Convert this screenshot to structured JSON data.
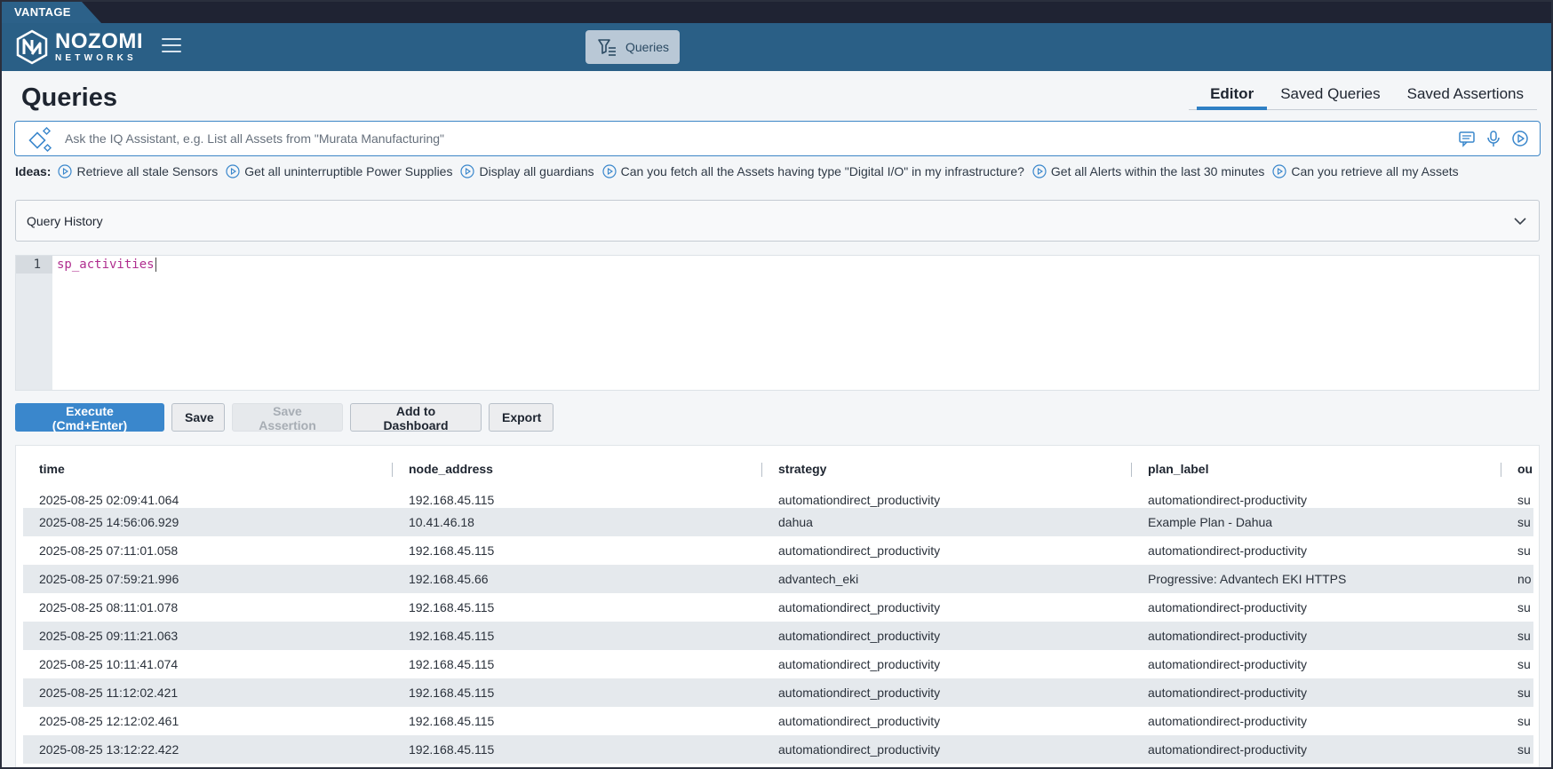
{
  "app": {
    "brand_strip": "VANTAGE",
    "logo_name": "NOZOMI",
    "logo_sub": "NETWORKS"
  },
  "nav": {
    "queries_label": "Queries"
  },
  "page": {
    "title": "Queries",
    "tabs": [
      {
        "label": "Editor",
        "active": true
      },
      {
        "label": "Saved Queries",
        "active": false
      },
      {
        "label": "Saved Assertions",
        "active": false
      }
    ]
  },
  "assistant": {
    "placeholder": "Ask the IQ Assistant, e.g. List all Assets from \"Murata Manufacturing\""
  },
  "ideas": {
    "label": "Ideas:",
    "items": [
      "Retrieve all stale Sensors",
      "Get all uninterruptible Power Supplies",
      "Display all guardians",
      "Can you fetch all the Assets having type \"Digital I/O\" in my infrastructure?",
      "Get all Alerts within the last 30 minutes",
      "Can you retrieve all my Assets"
    ]
  },
  "query_history": {
    "label": "Query History"
  },
  "editor": {
    "line_number": "1",
    "code": "sp_activities"
  },
  "buttons": {
    "execute": "Execute (Cmd+Enter)",
    "save": "Save",
    "save_assertion": "Save Assertion",
    "add_to_dashboard": "Add to Dashboard",
    "export": "Export"
  },
  "results": {
    "columns": [
      "time",
      "node_address",
      "strategy",
      "plan_label",
      "ou"
    ],
    "rows": [
      [
        "2025-08-25 02:09:41.064",
        "192.168.45.115",
        "automationdirect_productivity",
        "automationdirect-productivity",
        "su"
      ],
      [
        "2025-08-25 14:56:06.929",
        "10.41.46.18",
        "dahua",
        "Example Plan - Dahua",
        "su"
      ],
      [
        "2025-08-25 07:11:01.058",
        "192.168.45.115",
        "automationdirect_productivity",
        "automationdirect-productivity",
        "su"
      ],
      [
        "2025-08-25 07:59:21.996",
        "192.168.45.66",
        "advantech_eki",
        "Progressive: Advantech EKI HTTPS",
        "no"
      ],
      [
        "2025-08-25 08:11:01.078",
        "192.168.45.115",
        "automationdirect_productivity",
        "automationdirect-productivity",
        "su"
      ],
      [
        "2025-08-25 09:11:21.063",
        "192.168.45.115",
        "automationdirect_productivity",
        "automationdirect-productivity",
        "su"
      ],
      [
        "2025-08-25 10:11:41.074",
        "192.168.45.115",
        "automationdirect_productivity",
        "automationdirect-productivity",
        "su"
      ],
      [
        "2025-08-25 11:12:02.421",
        "192.168.45.115",
        "automationdirect_productivity",
        "automationdirect-productivity",
        "su"
      ],
      [
        "2025-08-25 12:12:02.461",
        "192.168.45.115",
        "automationdirect_productivity",
        "automationdirect-productivity",
        "su"
      ],
      [
        "2025-08-25 13:12:22.422",
        "192.168.45.115",
        "automationdirect_productivity",
        "automationdirect-productivity",
        "su"
      ]
    ]
  },
  "colors": {
    "header": "#2a5f86",
    "accent": "#3a87cc",
    "code": "#b02e8f"
  }
}
